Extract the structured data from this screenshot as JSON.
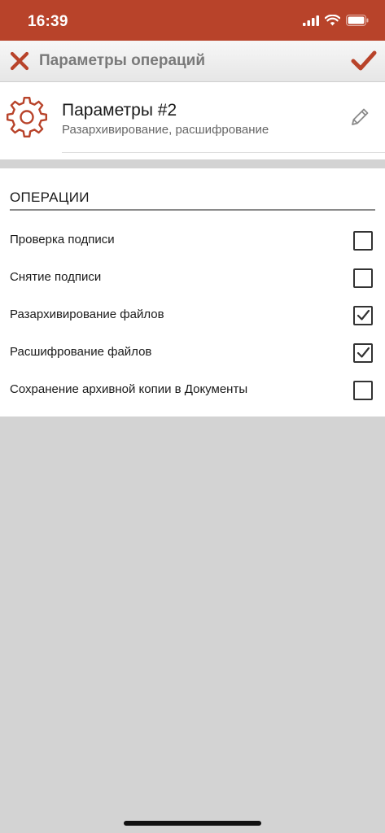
{
  "status_bar": {
    "time": "16:39",
    "icons": [
      "cellular-signal-icon",
      "wifi-icon",
      "battery-icon"
    ]
  },
  "nav": {
    "title": "Параметры операций",
    "close_icon": "close-icon",
    "confirm_icon": "checkmark-icon"
  },
  "profile": {
    "name": "Параметры #2",
    "description": "Разархивирование, расшифрование",
    "icon": "gear-icon",
    "edit_icon": "pencil-icon"
  },
  "operations": {
    "header": "ОПЕРАЦИИ",
    "items": [
      {
        "label": "Проверка подписи",
        "checked": false
      },
      {
        "label": "Снятие подписи",
        "checked": false
      },
      {
        "label": "Разархивирование файлов",
        "checked": true
      },
      {
        "label": "Расшифрование файлов",
        "checked": true
      },
      {
        "label": "Сохранение архивной копии в Документы",
        "checked": false
      }
    ]
  },
  "colors": {
    "accent": "#b8432a",
    "background": "#d3d3d3"
  }
}
